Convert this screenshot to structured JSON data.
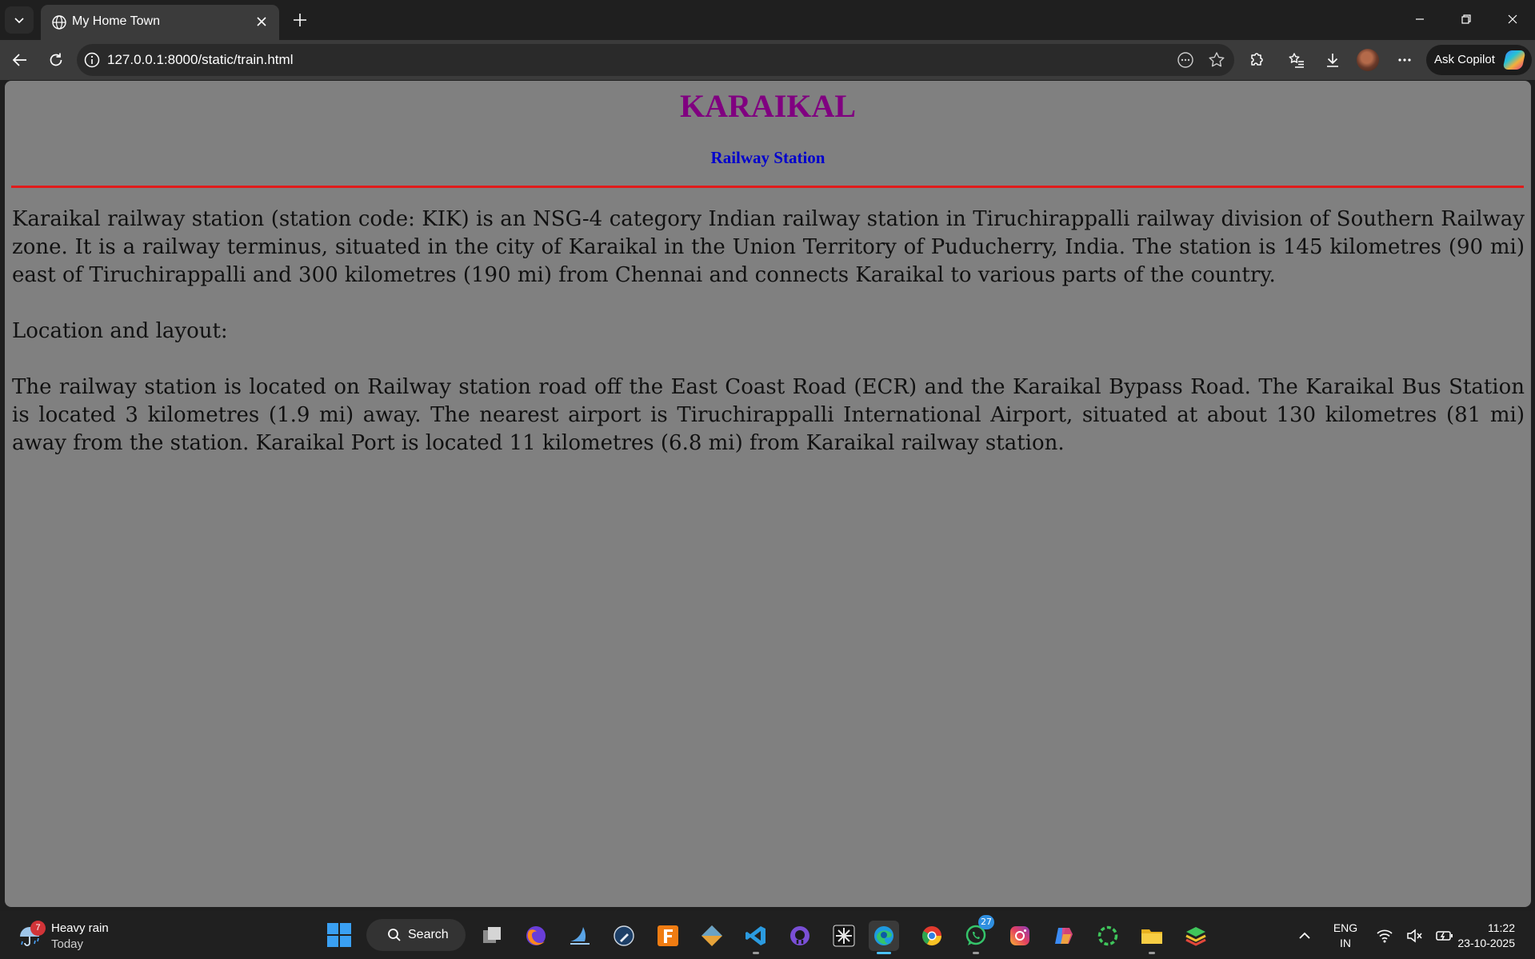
{
  "browser": {
    "tab": {
      "title": "My Home Town"
    },
    "address": {
      "url": "127.0.0.1:8000/static/train.html"
    },
    "copilot": {
      "label": "Ask Copilot"
    }
  },
  "page": {
    "background": "#808080",
    "title": "KARAIKAL",
    "title_color": "#800080",
    "subtitle": "Railway Station",
    "subtitle_color": "#0000cd",
    "rule_color": "#e11b1b",
    "paragraphs": [
      "Karaikal railway station (station code: KIK) is an NSG-4 category Indian railway station in Tiruchirappalli railway division of Southern Railway zone. It is a railway terminus, situated in the city of Karaikal in the Union Territory of Puducherry, India. The station is 145 kilometres (90 mi) east of Tiruchirappalli and 300 kilometres (190 mi) from Chennai and connects Karaikal to various parts of the country.",
      "Location and layout:",
      "The railway station is located on Railway station road off the East Coast Road (ECR) and the Karaikal Bypass Road. The Karaikal Bus Station is located 3 kilometres (1.9 mi) away. The nearest airport is Tiruchirappalli International Airport, situated at about 130 kilometres (81 mi) away from the station. Karaikal Port is located 11 kilometres (6.8 mi) from Karaikal railway station."
    ]
  },
  "taskbar": {
    "weather": {
      "badge": "7",
      "condition": "Heavy rain",
      "when": "Today"
    },
    "search_label": "Search",
    "apps": [
      {
        "name": "task-view",
        "icon": "task-view-icon"
      },
      {
        "name": "firefox",
        "icon": "firefox-icon"
      },
      {
        "name": "wireshark",
        "icon": "shark-fin-icon"
      },
      {
        "name": "inkscape",
        "icon": "pen-icon"
      },
      {
        "name": "fusion-360",
        "icon": "f360-icon",
        "glyph": "F"
      },
      {
        "name": "git",
        "icon": "git-diamond-icon"
      },
      {
        "name": "vscode",
        "icon": "vscode-icon"
      },
      {
        "name": "github-desktop",
        "icon": "github-icon"
      },
      {
        "name": "utility-app",
        "icon": "grid-glyph-icon"
      },
      {
        "name": "edge",
        "icon": "edge-icon"
      },
      {
        "name": "chrome",
        "icon": "chrome-icon"
      },
      {
        "name": "whatsapp",
        "icon": "whatsapp-icon",
        "count": "27"
      },
      {
        "name": "instagram",
        "icon": "instagram-icon"
      },
      {
        "name": "copilot",
        "icon": "copilot-icon"
      },
      {
        "name": "ring-app",
        "icon": "ring-icon"
      },
      {
        "name": "file-explorer",
        "icon": "folder-icon"
      },
      {
        "name": "stack-app",
        "icon": "layers-icon"
      }
    ],
    "language": {
      "line1": "ENG",
      "line2": "IN"
    },
    "clock": {
      "time": "11:22",
      "date": "23-10-2025"
    }
  }
}
